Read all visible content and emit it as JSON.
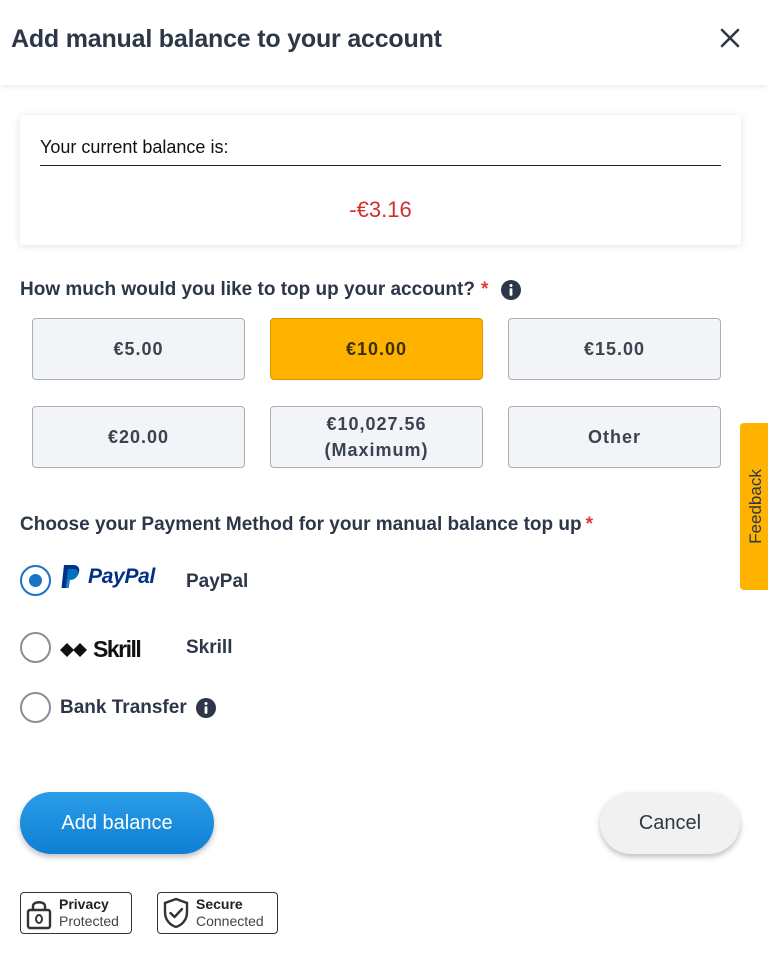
{
  "header": {
    "title": "Add manual balance to your account"
  },
  "balance": {
    "label": "Your current balance is:",
    "value": "-€3.16",
    "value_color": "#d32f2f"
  },
  "topup": {
    "question": "How much would you like to top up your account?",
    "required_mark": "*",
    "amounts": [
      {
        "label": "€5.00",
        "selected": false
      },
      {
        "label": "€10.00",
        "selected": true
      },
      {
        "label": "€15.00",
        "selected": false
      },
      {
        "label": "€20.00",
        "selected": false
      },
      {
        "label_line1": "€10,027.56",
        "label_line2": "(Maximum)",
        "selected": false
      },
      {
        "label": "Other",
        "selected": false
      }
    ]
  },
  "payment": {
    "title": "Choose your Payment Method for your manual balance top up",
    "required_mark": "*",
    "methods": [
      {
        "logo_text": "PayPal",
        "label": "PayPal",
        "selected": true
      },
      {
        "logo_text": "Skrill",
        "label": "Skrill",
        "selected": false
      },
      {
        "label": "Bank Transfer",
        "selected": false,
        "icon": "info-icon"
      }
    ]
  },
  "actions": {
    "add_label": "Add balance",
    "cancel_label": "Cancel"
  },
  "badges": [
    {
      "strong": "Privacy",
      "weak": "Protected",
      "icon": "lock-icon"
    },
    {
      "strong": "Secure",
      "weak": "Connected",
      "icon": "shield-check-icon"
    }
  ],
  "feedback": {
    "label": "Feedback"
  },
  "colors": {
    "accent": "#ffb200",
    "primary": "#1a73c8",
    "danger": "#d32f2f"
  }
}
